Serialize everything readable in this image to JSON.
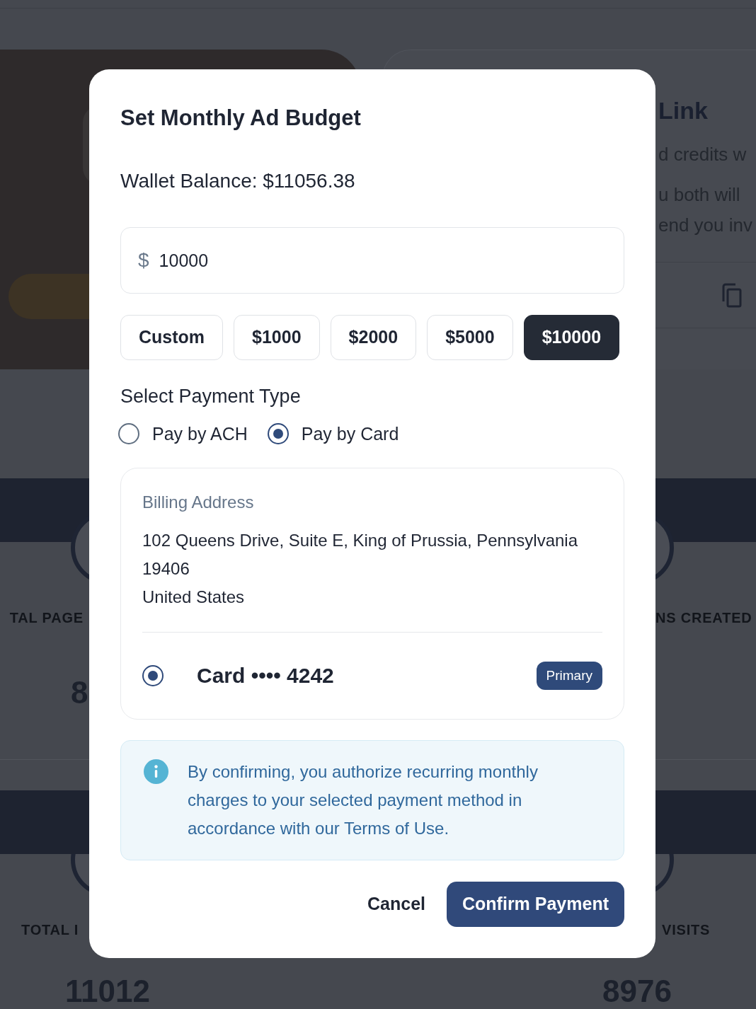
{
  "page": {
    "promo_card": {
      "title": "Link",
      "paragraphs": [
        [
          "d credits w"
        ],
        [
          "u both will",
          "end you inv"
        ]
      ]
    },
    "stat_rows": [
      {
        "cards": [
          {
            "label": "TAL PAGE",
            "value": "8"
          },
          {
            "label": "NS CREATED"
          }
        ]
      },
      {
        "cards": [
          {
            "label": "TOTAL I",
            "value": "11012"
          },
          {
            "label": "VISITS",
            "value": "8976"
          }
        ]
      }
    ]
  },
  "dialog": {
    "title": "Set Monthly Ad Budget",
    "wallet_balance": "Wallet Balance: $11056.38",
    "amount_field": {
      "prefix": "$",
      "value": "10000"
    },
    "presets": [
      {
        "label": "Custom",
        "selected": false
      },
      {
        "label": "$1000",
        "selected": false
      },
      {
        "label": "$2000",
        "selected": false
      },
      {
        "label": "$5000",
        "selected": false
      },
      {
        "label": "$10000",
        "selected": true
      }
    ],
    "payment_type": {
      "heading": "Select Payment Type",
      "options": [
        {
          "label": "Pay by ACH",
          "selected": false
        },
        {
          "label": "Pay by Card",
          "selected": true
        }
      ]
    },
    "billing": {
      "heading": "Billing Address",
      "address_lines": [
        "102 Queens Drive, Suite E, King of Prussia, Pennsylvania 19406",
        "United States"
      ],
      "card": {
        "label": "Card •••• 4242",
        "selected": true,
        "badge": "Primary"
      }
    },
    "notice": "By confirming, you authorize recurring monthly charges to your selected payment method in accordance with our Terms of Use.",
    "buttons": [
      {
        "label": "Cancel",
        "kind": "plain"
      },
      {
        "label": "Confirm Payment",
        "kind": "primary"
      }
    ]
  }
}
